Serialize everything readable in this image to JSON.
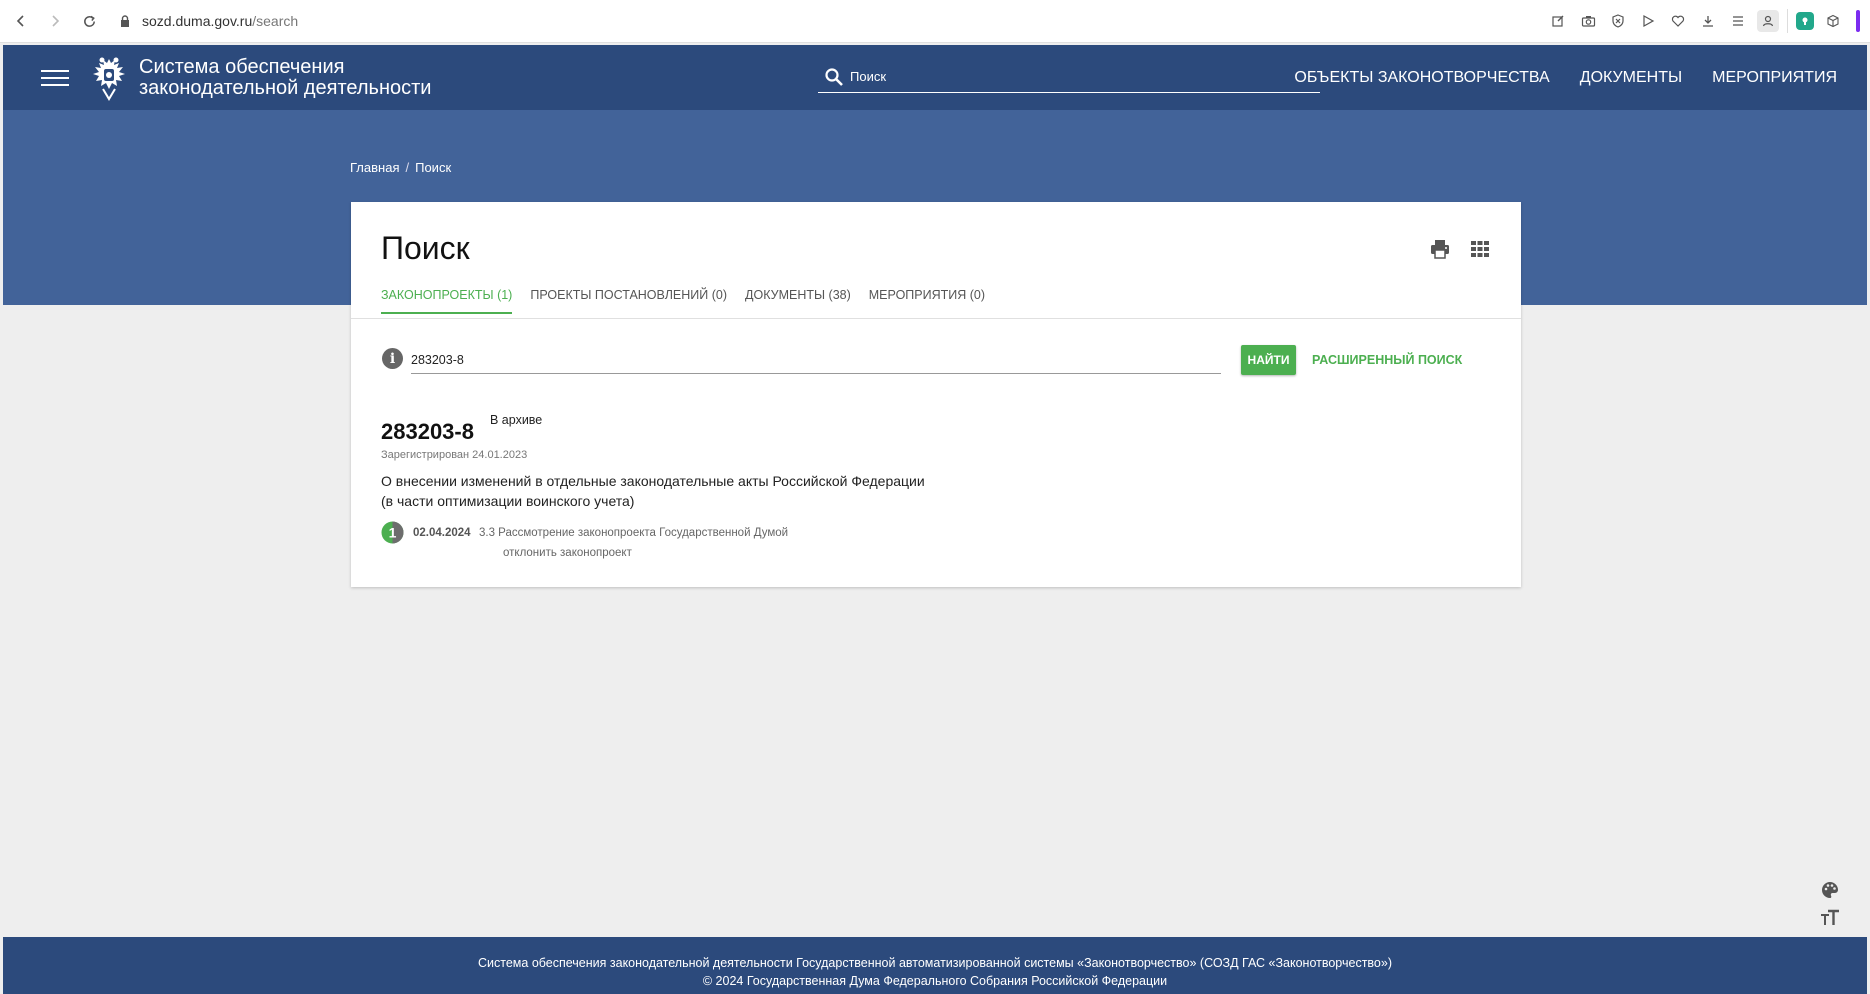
{
  "browser": {
    "url_host": "sozd.duma.gov.ru",
    "url_path": "/search"
  },
  "header": {
    "title_line1": "Система обеспечения",
    "title_line2": "законодательной деятельности",
    "search_placeholder": "Поиск",
    "nav": [
      "ОБЪЕКТЫ ЗАКОНОТВОРЧЕСТВА",
      "ДОКУМЕНТЫ",
      "МЕРОПРИЯТИЯ"
    ]
  },
  "breadcrumb": {
    "home": "Главная",
    "separator": "/",
    "current": "Поиск"
  },
  "card": {
    "title": "Поиск",
    "tabs": [
      {
        "label": "ЗАКОНОПРОЕКТЫ (1)",
        "active": true
      },
      {
        "label": "ПРОЕКТЫ ПОСТАНОВЛЕНИЙ (0)",
        "active": false
      },
      {
        "label": "ДОКУМЕНТЫ (38)",
        "active": false
      },
      {
        "label": "МЕРОПРИЯТИЯ (0)",
        "active": false
      }
    ],
    "query_value": "283203-8",
    "find_label": "НАЙТИ",
    "advanced_label": "РАСШИРЕННЫЙ ПОИСК"
  },
  "result": {
    "number": "283203-8",
    "status": "В архиве",
    "registered": "Зарегистрирован 24.01.2023",
    "desc_line1": "О внесении изменений в отдельные законодательные акты Российской Федерации",
    "desc_line2": "(в части оптимизации воинского учета)",
    "stage_number": "1",
    "stage_date": "02.04.2024",
    "stage_text": "3.3 Рассмотрение законопроекта Государственной Думой",
    "stage_decision": "отклонить законопроект"
  },
  "footer": {
    "line1": "Система обеспечения законодательной деятельности Государственной автоматизированной системы «Законотворчество» (СОЗД ГАС «Законотворчество»)",
    "copyright": "© 2024",
    "link": "Государственная Дума Федерального Собрания Российской Федерации"
  },
  "colors": {
    "header_bg": "#2c4a7c",
    "hero_bg": "#426399",
    "accent_green": "#4caf50"
  }
}
